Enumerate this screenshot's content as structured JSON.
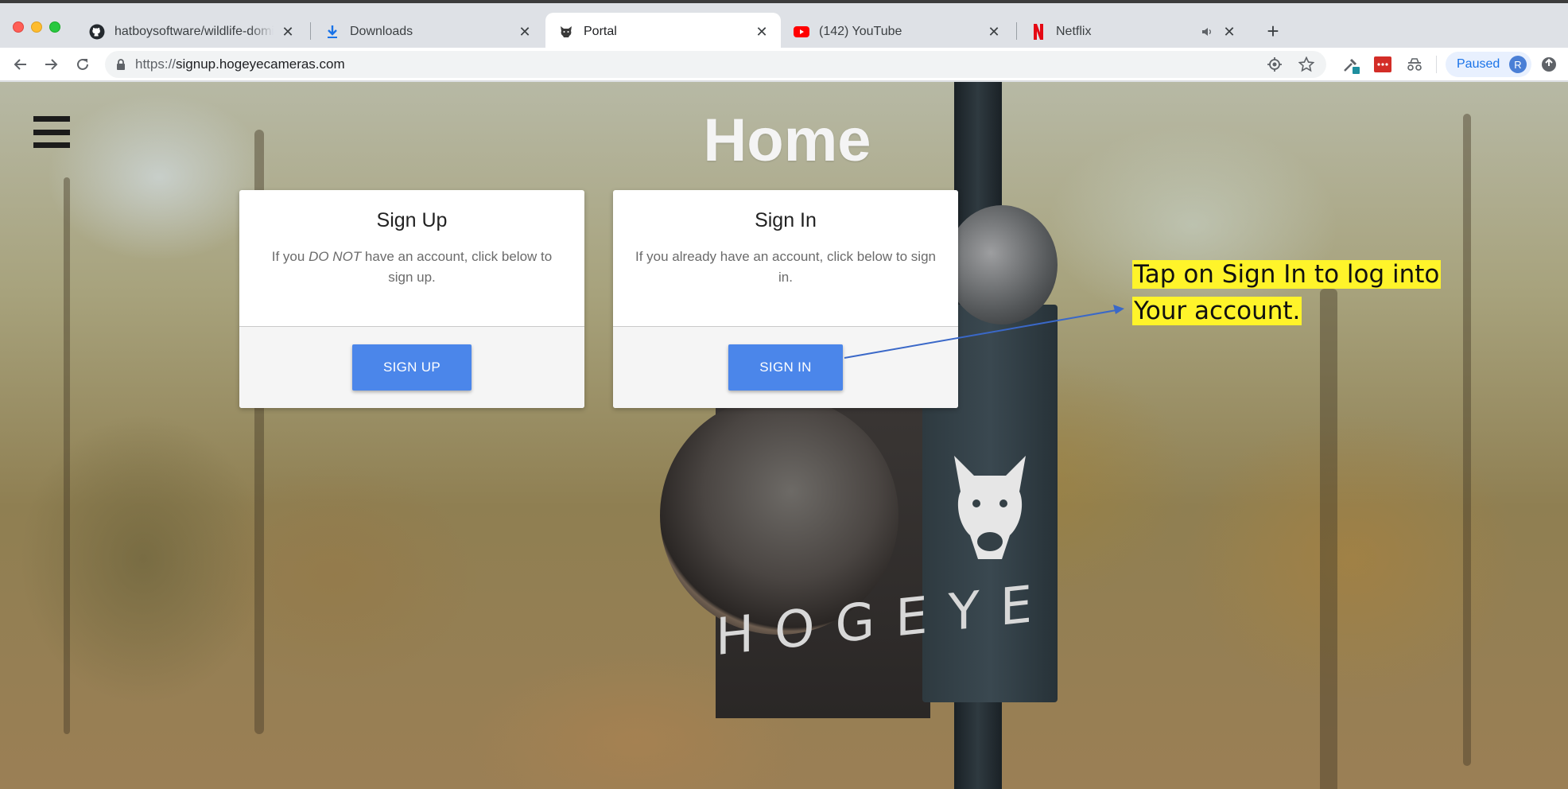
{
  "browser": {
    "tabs": [
      {
        "title": "hatboysoftware/wildlife-domin",
        "favicon": "github-icon",
        "active": false
      },
      {
        "title": "Downloads",
        "favicon": "download-icon",
        "active": false
      },
      {
        "title": "Portal",
        "favicon": "boar-icon",
        "active": true
      },
      {
        "title": "(142) YouTube",
        "favicon": "youtube-icon",
        "active": false
      },
      {
        "title": "Netflix",
        "favicon": "netflix-icon",
        "active": false,
        "audio": true
      }
    ],
    "url_scheme": "https://",
    "url_host": "signup.hogeyecameras.com",
    "profile_status": "Paused",
    "profile_initial": "R"
  },
  "page": {
    "title": "Home",
    "brand_text": "HOGEYE",
    "signup_card": {
      "heading": "Sign Up",
      "text_before": "If you ",
      "text_emphasis": "DO NOT",
      "text_after": " have an account, click below to sign up.",
      "button": "SIGN UP"
    },
    "signin_card": {
      "heading": "Sign In",
      "text": "If you already have an account, click below to sign in.",
      "button": "SIGN IN"
    }
  },
  "annotation": {
    "line1": "Tap on Sign In to log into",
    "line2": "Your account.",
    "highlight_color": "#fff42a",
    "arrow_color": "#3a68c8"
  },
  "colors": {
    "button": "#4b86ea",
    "tabstrip": "#dee1e6"
  }
}
